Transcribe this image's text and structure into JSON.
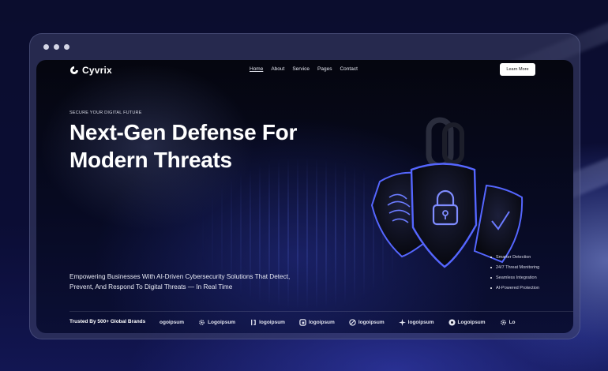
{
  "nav": {
    "brand": "Cyvrix",
    "items": [
      {
        "label": "Home",
        "active": true
      },
      {
        "label": "About"
      },
      {
        "label": "Service"
      },
      {
        "label": "Pages"
      },
      {
        "label": "Contact"
      }
    ],
    "cta": "Learn More"
  },
  "hero": {
    "eyebrow": "SECURE YOUR DIGITAL FUTURE",
    "title_line1": "Next-Gen Defense For",
    "title_line2": "Modern Threats",
    "subtitle_line1": "Empowering Businesses With AI-Driven Cybersecurity Solutions That Detect,",
    "subtitle_line2": "Prevent, And Respond To Digital Threats — In Real Time"
  },
  "features": [
    "Smarter Detection",
    "24/7 Threat Monitoring",
    "Seamless Integration",
    "AI-Powered Protection"
  ],
  "trusted": {
    "label": "Trusted By 500+ Global Brands",
    "logos": [
      {
        "text": "ogoipsum",
        "icon": "none"
      },
      {
        "text": "Logoipsum",
        "icon": "gear-icon"
      },
      {
        "text": "logoipsum",
        "icon": "bracket-icon"
      },
      {
        "text": "logoipsum",
        "icon": "square-icon"
      },
      {
        "text": "logoipsum",
        "icon": "slash-circle-icon"
      },
      {
        "text": "logoipsum",
        "icon": "sparkle-icon"
      },
      {
        "text": "Logoipsum",
        "icon": "flower-icon"
      },
      {
        "text": "Lo",
        "icon": "gear-icon"
      }
    ]
  },
  "colors": {
    "accent": "#4a5bff",
    "background": "#05060f"
  }
}
